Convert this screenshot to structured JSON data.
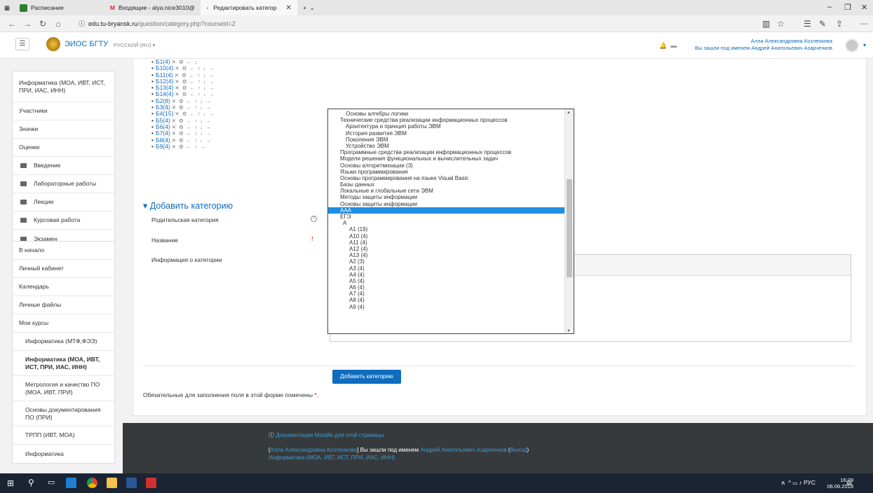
{
  "browser": {
    "tabs": [
      {
        "label": "Расписание",
        "color": "#2e7d32"
      },
      {
        "label": "Входящие - alya.nice3010@",
        "color": "#d93025"
      },
      {
        "label": "Редактировать категор",
        "color": "#f0a020"
      }
    ],
    "url_host": "edu.tu-bryansk.ru",
    "url_path": "/question/category.php?courseid=2"
  },
  "navbar": {
    "site_name": "ЭИОС БГТУ",
    "language": "РУССКИЙ (RU) ▾",
    "user_name": "Алла Александровна Козленкова",
    "login_as": "Вы зашли под именем Андрей Анатольевич Азарченков"
  },
  "drawer": {
    "course_items": [
      {
        "label": "Информатика (МОА, ИВТ, ИСТ, ПРИ, ИАС, ИНН)",
        "folder": false
      },
      {
        "label": "Участники",
        "folder": false
      },
      {
        "label": "Значки",
        "folder": false
      },
      {
        "label": "Оценки",
        "folder": false
      },
      {
        "label": "Введение",
        "folder": true
      },
      {
        "label": "Лабораторные работы",
        "folder": true
      },
      {
        "label": "Лекции",
        "folder": true
      },
      {
        "label": "Курсовая работа",
        "folder": true
      },
      {
        "label": "Экзамен",
        "folder": true
      }
    ],
    "site_items": [
      {
        "label": "В начало",
        "cls": ""
      },
      {
        "label": "Личный кабинет",
        "cls": ""
      },
      {
        "label": "Календарь",
        "cls": ""
      },
      {
        "label": "Личные файлы",
        "cls": ""
      },
      {
        "label": "Мои курсы",
        "cls": ""
      },
      {
        "label": "Информатика (МТФ,ФЭЭ)",
        "cls": "sub"
      },
      {
        "label": "Информатика (МОА, ИВТ, ИСТ, ПРИ, ИАС, ИНН)",
        "cls": "sub bold"
      },
      {
        "label": "Метрология и качество ПО (МОА, ИВТ, ПРИ)",
        "cls": "sub"
      },
      {
        "label": "Основы документирования ПО (ПРИ)",
        "cls": "sub"
      },
      {
        "label": "ТРПП (ИВТ, МОА)",
        "cls": "sub"
      },
      {
        "label": "Информатика",
        "cls": "sub"
      }
    ]
  },
  "categories": [
    {
      "name": "Б1",
      "count": "(4)",
      "actions": "✕ ⚙ ← ↓"
    },
    {
      "name": "Б10",
      "count": "(4)",
      "actions": "✕ ⚙ ← ↑ ↓ →"
    },
    {
      "name": "Б11",
      "count": "(4)",
      "actions": "✕ ⚙ ← ↑ ↓ →"
    },
    {
      "name": "Б12",
      "count": "(4)",
      "actions": "✕ ⚙ ← ↑ ↓ →"
    },
    {
      "name": "Б13",
      "count": "(4)",
      "actions": "✕ ⚙ ← ↑ ↓ →"
    },
    {
      "name": "Б14",
      "count": "(4)",
      "actions": "✕ ⚙ ← ↑ ↓ →"
    },
    {
      "name": "Б2",
      "count": "(8)",
      "actions": "✕ ⚙ ← ↑ ↓ →"
    },
    {
      "name": "Б3",
      "count": "(4)",
      "actions": "✕ ⚙ ← ↑ ↓ →"
    },
    {
      "name": "Б4",
      "count": "(15)",
      "actions": "✕ ⚙ ← ↑ ↓ →"
    },
    {
      "name": "Б5",
      "count": "(4)",
      "actions": "✕ ⚙ ← ↑ ↓ →"
    },
    {
      "name": "Б6",
      "count": "(4)",
      "actions": "✕ ⚙ ← ↑ ↓ →"
    },
    {
      "name": "Б7",
      "count": "(4)",
      "actions": "✕ ⚙ ← ↑ ↓ →"
    },
    {
      "name": "Б8",
      "count": "(4)",
      "actions": "✕ ⚙ ← ↑ ↓ →"
    },
    {
      "name": "Б9",
      "count": "(4)",
      "actions": "✕ ⚙ ← ↑ →"
    }
  ],
  "form": {
    "heading": "▾ Добавить категорию",
    "parent_label": "Родительская категория",
    "name_label": "Название",
    "info_label": "Информация о категории",
    "submit": "Добавить категорию",
    "required_note": "Обязательные для заполнения поля в этой форме помечены",
    "required_mark": "*."
  },
  "parent_options": [
    {
      "label": "Основы алгебры логики",
      "lvl": "l1",
      "sel": false
    },
    {
      "label": "Технические средства реализации информационных процессов",
      "lvl": "",
      "sel": false
    },
    {
      "label": "Архитектура и принцип работы ЭВМ",
      "lvl": "l1",
      "sel": false
    },
    {
      "label": "История развития ЭВМ",
      "lvl": "l1",
      "sel": false
    },
    {
      "label": "Поколения ЭВМ",
      "lvl": "l1",
      "sel": false
    },
    {
      "label": "Устройство ЭВМ",
      "lvl": "l1",
      "sel": false
    },
    {
      "label": "Программные средства реализации информационных процессов",
      "lvl": "",
      "sel": false
    },
    {
      "label": "Модели решения функциональных и вычислительных задач",
      "lvl": "",
      "sel": false
    },
    {
      "label": "Основы алгоритмизации (3)",
      "lvl": "",
      "sel": false
    },
    {
      "label": "Языки программирования",
      "lvl": "",
      "sel": false
    },
    {
      "label": "Основы программирования на языке Visual Basic",
      "lvl": "",
      "sel": false
    },
    {
      "label": "Базы данных",
      "lvl": "",
      "sel": false
    },
    {
      "label": "Локальные и глобальные сети ЭВМ",
      "lvl": "",
      "sel": false
    },
    {
      "label": "Методы защиты информации",
      "lvl": "",
      "sel": false
    },
    {
      "label": "Основы защиты информации",
      "lvl": "",
      "sel": false
    },
    {
      "label": "ААА",
      "lvl": "",
      "sel": true
    },
    {
      "label": "ЕГЭ",
      "lvl": "",
      "sel": false
    },
    {
      "label": "А",
      "lvl": "l0",
      "sel": false
    },
    {
      "label": "А1 (19)",
      "lvl": "l2",
      "sel": false
    },
    {
      "label": "А10 (4)",
      "lvl": "l2",
      "sel": false
    },
    {
      "label": "А11 (4)",
      "lvl": "l2",
      "sel": false
    },
    {
      "label": "А12 (4)",
      "lvl": "l2",
      "sel": false
    },
    {
      "label": "А13 (4)",
      "lvl": "l2",
      "sel": false
    },
    {
      "label": "А2 (3)",
      "lvl": "l2",
      "sel": false
    },
    {
      "label": "А3 (4)",
      "lvl": "l2",
      "sel": false
    },
    {
      "label": "А4 (4)",
      "lvl": "l2",
      "sel": false
    },
    {
      "label": "А5 (4)",
      "lvl": "l2",
      "sel": false
    },
    {
      "label": "А6 (4)",
      "lvl": "l2",
      "sel": false
    },
    {
      "label": "А7 (4)",
      "lvl": "l2",
      "sel": false
    },
    {
      "label": "А8 (4)",
      "lvl": "l2",
      "sel": false
    },
    {
      "label": "А9 (4)",
      "lvl": "l2",
      "sel": false
    }
  ],
  "footer": {
    "docs_link": "Документация Moodle для этой страницы",
    "user_link": "Алла Александровна Козленкова",
    "login_as": "Вы зашли под именем",
    "login_user": "Андрей Анатольевич Азарченков",
    "logout": "Выход",
    "course_link": "Информатика (МОА, ИВТ, ИСТ, ПРИ, ИАС, ИНН)"
  },
  "taskbar": {
    "lang": "РУС",
    "time": "16:29",
    "date": "06.06.2018"
  }
}
